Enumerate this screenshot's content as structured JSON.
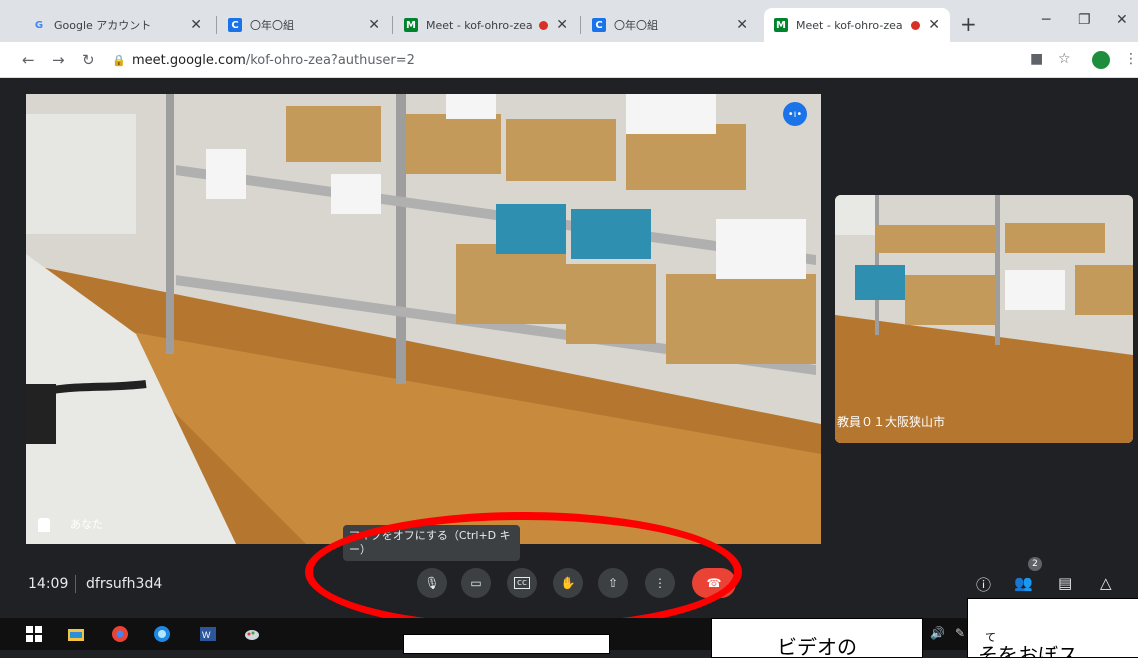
{
  "browser": {
    "tabs": [
      {
        "label": "Google アカウント",
        "favicon": "G"
      },
      {
        "label": "〇年〇組",
        "favicon": "C"
      },
      {
        "label": "Meet - kof-ohro-zea",
        "favicon": "M",
        "recording": true
      },
      {
        "label": "〇年〇組",
        "favicon": "C"
      },
      {
        "label": "Meet - kof-ohro-zea",
        "favicon": "M",
        "recording": true
      }
    ],
    "url_host": "meet.google.com",
    "url_path": "/kof-ohro-zea?authuser=2"
  },
  "meet": {
    "self_name": "あなた",
    "remote_name": "教員０１大阪狭山市",
    "tooltip": "マイクをオフにする（Ctrl+D キー）",
    "time": "14:09",
    "meeting_code": "dfrsufh3d4",
    "participants_count": "2"
  },
  "overlay": {
    "box2": "ビデオの",
    "box3": "そをおぼス",
    "box3_ruby": "て"
  },
  "colors": {
    "end_call": "#ea4335",
    "accent": "#1a73e8",
    "annotation": "#ff0000"
  }
}
